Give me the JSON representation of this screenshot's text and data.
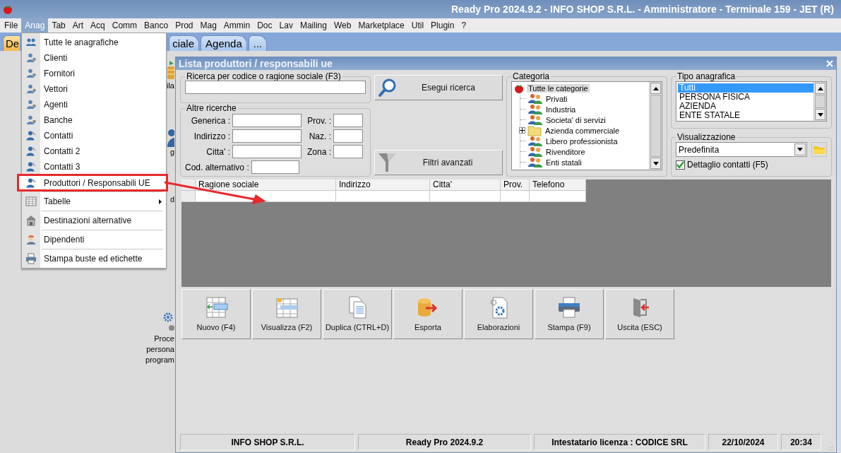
{
  "title_bar": {
    "title": "Ready Pro 2024.9.2 - INFO SHOP S.R.L. - Amministratore - Terminale 159 - JET (R)"
  },
  "menu_bar": [
    {
      "label": "File",
      "selected": false
    },
    {
      "label": "Anag",
      "selected": true
    },
    {
      "label": "Tab",
      "selected": false
    },
    {
      "label": "Art",
      "selected": false
    },
    {
      "label": "Acq",
      "selected": false
    },
    {
      "label": "Comm",
      "selected": false
    },
    {
      "label": "Banco",
      "selected": false
    },
    {
      "label": "Prod",
      "selected": false
    },
    {
      "label": "Mag",
      "selected": false
    },
    {
      "label": "Ammin",
      "selected": false
    },
    {
      "label": "Doc",
      "selected": false
    },
    {
      "label": "Lav",
      "selected": false
    },
    {
      "label": "Mailing",
      "selected": false
    },
    {
      "label": "Web",
      "selected": false
    },
    {
      "label": "Marketplace",
      "selected": false
    },
    {
      "label": "Util",
      "selected": false
    },
    {
      "label": "Plugin",
      "selected": false
    },
    {
      "label": "?",
      "selected": false
    }
  ],
  "tabs": [
    {
      "label": "De",
      "selected": true
    },
    {
      "label": "ciale",
      "selected": false
    },
    {
      "label": "Agenda",
      "selected": false
    },
    {
      "label": "...",
      "selected": false
    }
  ],
  "desktop_icons": [
    {
      "label": "ila"
    },
    {
      "label": "g"
    },
    {
      "label": "d"
    },
    {
      "label": "Proce\npersona\nprogram"
    }
  ],
  "anag_menu": [
    {
      "kind": "item",
      "label": "Tutte le anagrafiche",
      "highlighted": false
    },
    {
      "kind": "item",
      "label": "Clienti",
      "highlighted": false
    },
    {
      "kind": "item",
      "label": "Fornitori",
      "highlighted": false
    },
    {
      "kind": "item",
      "label": "Vettori",
      "highlighted": false
    },
    {
      "kind": "item",
      "label": "Agenti",
      "highlighted": false
    },
    {
      "kind": "item",
      "label": "Banche",
      "highlighted": false
    },
    {
      "kind": "item",
      "label": "Contatti",
      "highlighted": false
    },
    {
      "kind": "item",
      "label": "Contatti 2",
      "highlighted": false
    },
    {
      "kind": "item",
      "label": "Contatti 3",
      "highlighted": false
    },
    {
      "kind": "item",
      "label": "Produttori / Responsabili UE",
      "highlighted": true
    },
    {
      "kind": "separator"
    },
    {
      "kind": "submenu",
      "label": "Tabelle",
      "highlighted": false
    },
    {
      "kind": "separator"
    },
    {
      "kind": "item",
      "label": "Destinazioni alternative",
      "highlighted": false
    },
    {
      "kind": "separator"
    },
    {
      "kind": "item",
      "label": "Dipendenti",
      "highlighted": false
    },
    {
      "kind": "separator"
    },
    {
      "kind": "item",
      "label": "Stampa buste ed etichette",
      "highlighted": false
    }
  ],
  "window": {
    "title": "Lista produttori / responsabili ue",
    "search": {
      "legend": "Ricerca per codice o ragione sociale (F3)"
    },
    "other_searches": {
      "legend": "Altre ricerche",
      "left_fields": [
        "Generica :",
        "Indirizzo :",
        "Citta' :",
        "Cod. alternativo :"
      ],
      "right_fields": [
        "Prov. :",
        "Naz. :",
        "Zona :"
      ]
    },
    "search_button": "Esegui ricerca",
    "filter_button": "Filtri avanzati",
    "category": {
      "legend": "Categoria",
      "tree": [
        {
          "label": "Tutte le categorie",
          "kind": "root",
          "selected": true,
          "children": [
            {
              "label": "Privati",
              "kind": "group",
              "selected": false
            },
            {
              "label": "Industria",
              "kind": "group",
              "selected": false
            },
            {
              "label": "Societa' di servizi",
              "kind": "group",
              "selected": false
            },
            {
              "label": "Azienda commerciale",
              "kind": "folder",
              "selected": false,
              "expanded": false
            },
            {
              "label": "Libero professionista",
              "kind": "group",
              "selected": false
            },
            {
              "label": "Rivenditore",
              "kind": "group",
              "selected": false
            },
            {
              "label": "Enti statali",
              "kind": "group",
              "selected": false
            }
          ]
        }
      ]
    },
    "type": {
      "legend": "Tipo anagrafica",
      "options": [
        {
          "label": "Tutti",
          "selected": true
        },
        {
          "label": "PERSONA FISICA",
          "selected": false
        },
        {
          "label": "AZIENDA",
          "selected": false
        },
        {
          "label": "ENTE STATALE",
          "selected": false
        }
      ]
    },
    "view": {
      "legend": "Visualizzazione",
      "value": "Predefinita",
      "detail_checkbox": {
        "label": "Dettaglio contatti (F5)",
        "checked": true
      }
    },
    "grid": {
      "columns": [
        "Ragione sociale",
        "Indirizzo",
        "Citta'",
        "Prov.",
        "Telefono"
      ]
    },
    "buttons": [
      "Nuovo (F4)",
      "Visualizza (F2)",
      "Duplica (CTRL+D)",
      "Esporta",
      "Elaborazioni",
      "Stampa (F9)",
      "Uscita (ESC)"
    ],
    "status_bar": [
      "INFO SHOP S.R.L.",
      "Ready Pro 2024.9.2",
      "Intestatario licenza : CODICE SRL",
      "22/10/2024",
      "20:34"
    ]
  }
}
